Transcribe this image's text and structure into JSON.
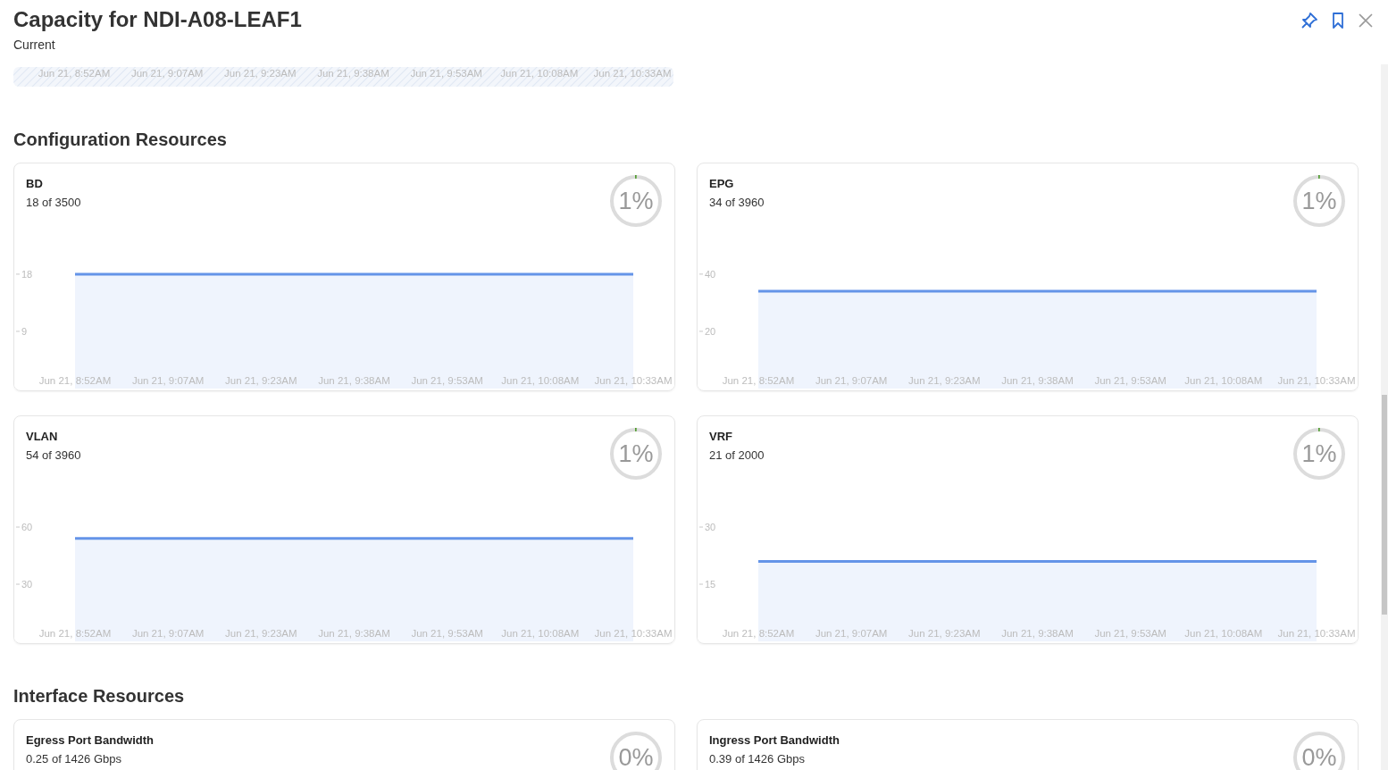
{
  "header": {
    "title": "Capacity for NDI-A08-LEAF1",
    "subtitle": "Current"
  },
  "previous_chart": {
    "x_labels": [
      "Jun 21, 8:52AM",
      "Jun 21, 9:07AM",
      "Jun 21, 9:23AM",
      "Jun 21, 9:38AM",
      "Jun 21, 9:53AM",
      "Jun 21, 10:08AM",
      "Jun 21, 10:33AM"
    ]
  },
  "sections": [
    {
      "title": "Configuration Resources",
      "cards": [
        {
          "title": "BD",
          "subtitle": "18 of 3500",
          "gauge": {
            "label": "1%",
            "level": 0.01
          },
          "chart_data": {
            "type": "area",
            "categories": [
              "Jun 21, 8:52AM",
              "Jun 21, 9:07AM",
              "Jun 21, 9:23AM",
              "Jun 21, 9:38AM",
              "Jun 21, 9:53AM",
              "Jun 21, 10:08AM",
              "Jun 21, 10:33AM"
            ],
            "ylim": [
              0,
              25.3
            ],
            "yticks": [
              9,
              18
            ],
            "series": [
              {
                "color": "#6494e8",
                "values": [
                  18,
                  18,
                  18,
                  18,
                  18,
                  18,
                  18
                ]
              }
            ]
          }
        },
        {
          "title": "EPG",
          "subtitle": "34 of 3960",
          "gauge": {
            "label": "1%",
            "level": 0.01
          },
          "chart_data": {
            "type": "area",
            "categories": [
              "Jun 21, 8:52AM",
              "Jun 21, 9:07AM",
              "Jun 21, 9:23AM",
              "Jun 21, 9:38AM",
              "Jun 21, 9:53AM",
              "Jun 21, 10:08AM",
              "Jun 21, 10:33AM"
            ],
            "ylim": [
              0,
              56.2
            ],
            "yticks": [
              20,
              40
            ],
            "series": [
              {
                "color": "#6494e8",
                "values": [
                  34,
                  34,
                  34,
                  34,
                  34,
                  34,
                  34
                ]
              }
            ]
          }
        },
        {
          "title": "VLAN",
          "subtitle": "54 of 3960",
          "gauge": {
            "label": "1%",
            "level": 0.01
          },
          "chart_data": {
            "type": "area",
            "categories": [
              "Jun 21, 8:52AM",
              "Jun 21, 9:07AM",
              "Jun 21, 9:23AM",
              "Jun 21, 9:38AM",
              "Jun 21, 9:53AM",
              "Jun 21, 10:08AM",
              "Jun 21, 10:33AM"
            ],
            "ylim": [
              0,
              84.4
            ],
            "yticks": [
              30,
              60
            ],
            "series": [
              {
                "color": "#6494e8",
                "values": [
                  54,
                  54,
                  54,
                  54,
                  54,
                  54,
                  54
                ]
              }
            ]
          }
        },
        {
          "title": "VRF",
          "subtitle": "21 of 2000",
          "gauge": {
            "label": "1%",
            "level": 0.01
          },
          "chart_data": {
            "type": "area",
            "categories": [
              "Jun 21, 8:52AM",
              "Jun 21, 9:07AM",
              "Jun 21, 9:23AM",
              "Jun 21, 9:38AM",
              "Jun 21, 9:53AM",
              "Jun 21, 10:08AM",
              "Jun 21, 10:33AM"
            ],
            "ylim": [
              0,
              42.2
            ],
            "yticks": [
              15,
              30
            ],
            "series": [
              {
                "color": "#6494e8",
                "values": [
                  21,
                  21,
                  21,
                  21,
                  21,
                  21,
                  21
                ]
              }
            ]
          }
        }
      ]
    },
    {
      "title": "Interface Resources",
      "cards": [
        {
          "title": "Egress Port Bandwidth",
          "subtitle": "0.25 of 1426 Gbps",
          "gauge": {
            "label": "0%"
          }
        },
        {
          "title": "Ingress Port Bandwidth",
          "subtitle": "0.39 of 1426 Gbps",
          "gauge": {
            "label": "0%"
          }
        }
      ]
    }
  ]
}
